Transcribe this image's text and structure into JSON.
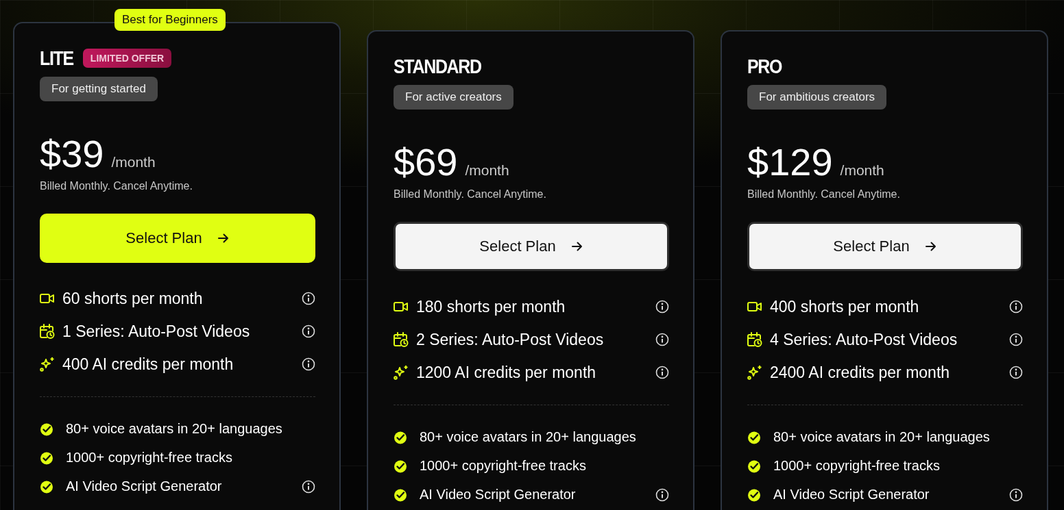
{
  "plans": [
    {
      "name": "LITE",
      "featured": true,
      "ribbon": "Best for Beginners",
      "badge": "LIMITED OFFER",
      "tagline": "For getting started",
      "price": "$39",
      "period": "/month",
      "billing": "Billed Monthly. Cancel Anytime.",
      "button": {
        "label": "Select Plan",
        "highlighted": true
      },
      "features": [
        {
          "kind": "video",
          "text": "60 shorts per month",
          "info": true
        },
        {
          "kind": "calendar",
          "text": "1 Series: Auto-Post Videos",
          "info": true
        },
        {
          "kind": "sparkle",
          "text": "400 AI credits per month",
          "info": true
        }
      ],
      "perks": [
        {
          "text": "80+ voice avatars in 20+ languages",
          "info": false
        },
        {
          "text": "1000+ copyright-free tracks",
          "info": false
        },
        {
          "text": "AI Video Script Generator",
          "info": true
        }
      ]
    },
    {
      "name": "STANDARD",
      "featured": false,
      "tagline": "For active creators",
      "price": "$69",
      "period": "/month",
      "billing": "Billed Monthly. Cancel Anytime.",
      "button": {
        "label": "Select Plan",
        "highlighted": false
      },
      "features": [
        {
          "kind": "video",
          "text": "180 shorts per month",
          "info": true
        },
        {
          "kind": "calendar",
          "text": "2 Series: Auto-Post Videos",
          "info": true
        },
        {
          "kind": "sparkle",
          "text": "1200 AI credits per month",
          "info": true
        }
      ],
      "perks": [
        {
          "text": "80+ voice avatars in 20+ languages",
          "info": false
        },
        {
          "text": "1000+ copyright-free tracks",
          "info": false
        },
        {
          "text": "AI Video Script Generator",
          "info": true
        }
      ]
    },
    {
      "name": "PRO",
      "featured": false,
      "tagline": "For ambitious creators",
      "price": "$129",
      "period": "/month",
      "billing": "Billed Monthly. Cancel Anytime.",
      "button": {
        "label": "Select Plan",
        "highlighted": false
      },
      "features": [
        {
          "kind": "video",
          "text": "400 shorts per month",
          "info": true
        },
        {
          "kind": "calendar",
          "text": "4 Series: Auto-Post Videos",
          "info": true
        },
        {
          "kind": "sparkle",
          "text": "2400 AI credits per month",
          "info": true
        }
      ],
      "perks": [
        {
          "text": "80+ voice avatars in 20+ languages",
          "info": false
        },
        {
          "text": "1000+ copyright-free tracks",
          "info": false
        },
        {
          "text": "AI Video Script Generator",
          "info": true
        }
      ]
    }
  ]
}
